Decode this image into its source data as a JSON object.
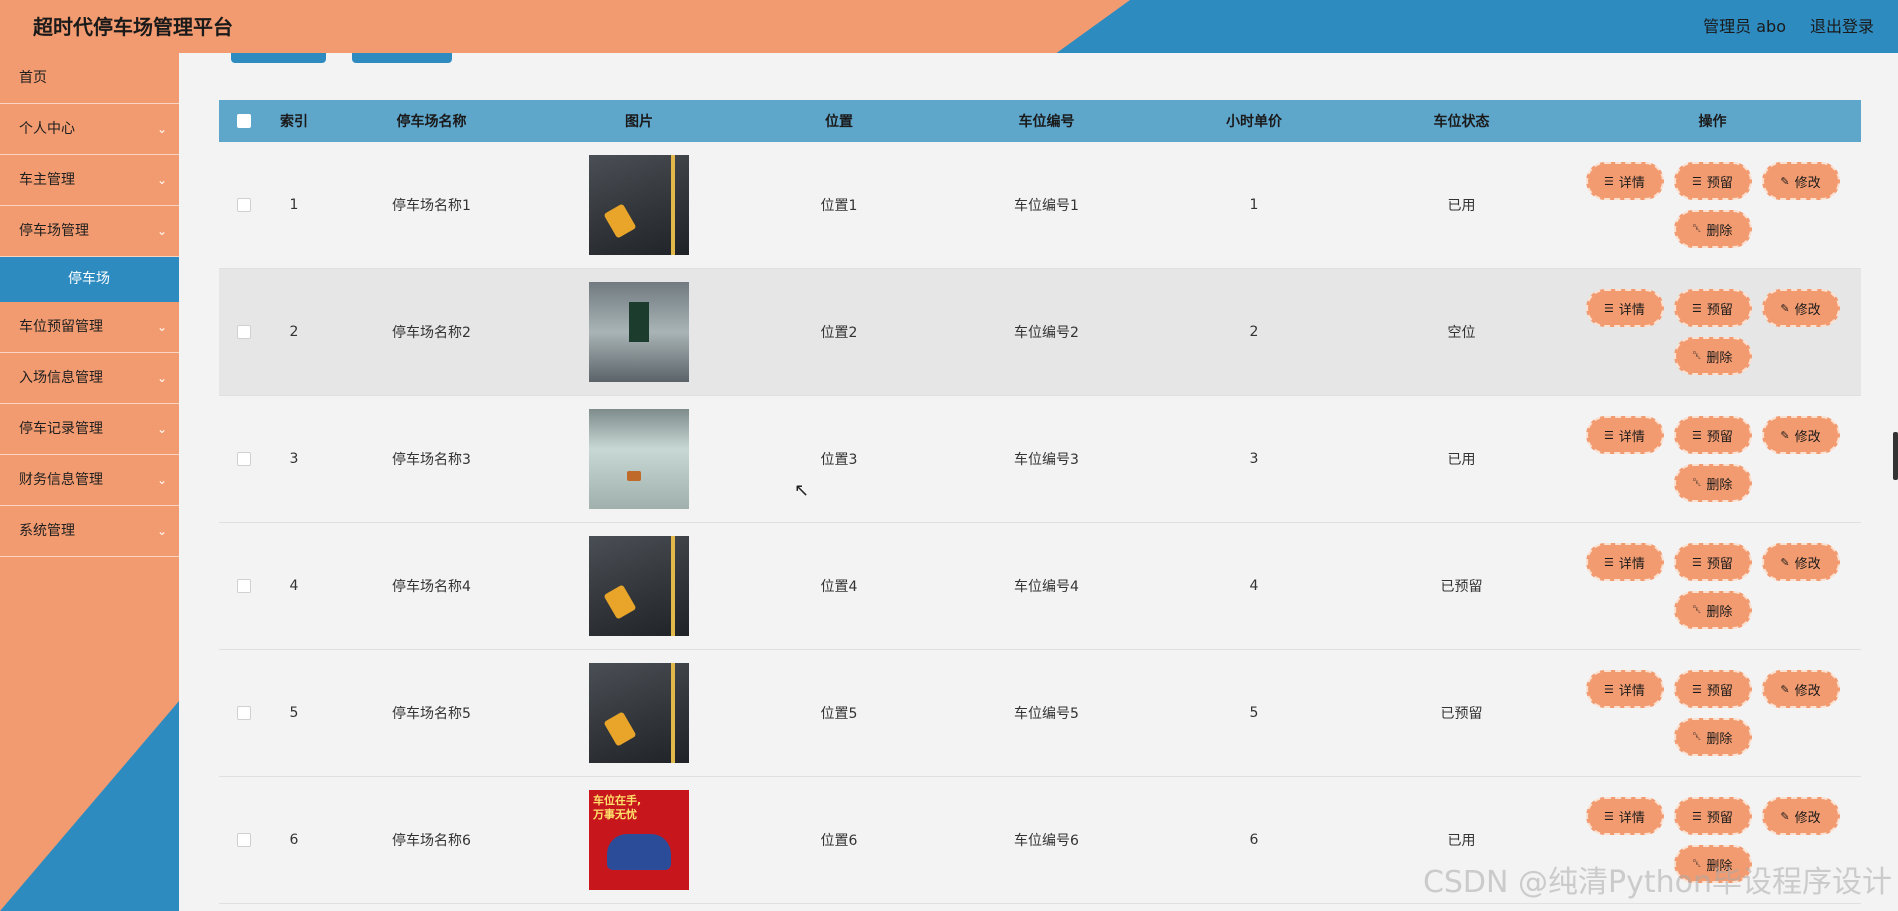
{
  "header": {
    "title": "超时代停车场管理平台",
    "user": "管理员 abo",
    "logout": "退出登录"
  },
  "sidebar": {
    "items": [
      {
        "label": "首页",
        "chevron": false
      },
      {
        "label": "个人中心",
        "chevron": true
      },
      {
        "label": "车主管理",
        "chevron": true
      },
      {
        "label": "停车场管理",
        "chevron": true
      },
      {
        "label": "停车场",
        "sub": true
      },
      {
        "label": "车位预留管理",
        "chevron": true
      },
      {
        "label": "入场信息管理",
        "chevron": true
      },
      {
        "label": "停车记录管理",
        "chevron": true
      },
      {
        "label": "财务信息管理",
        "chevron": true
      },
      {
        "label": "系统管理",
        "chevron": true
      }
    ]
  },
  "table": {
    "headers": [
      "索引",
      "停车场名称",
      "图片",
      "位置",
      "车位编号",
      "小时单价",
      "车位状态",
      "操作"
    ],
    "rows": [
      {
        "index": "1",
        "name": "停车场名称1",
        "image": "parking-lock",
        "location": "位置1",
        "space_no": "车位编号1",
        "price": "1",
        "status": "已用"
      },
      {
        "index": "2",
        "name": "停车场名称2",
        "image": "garage",
        "location": "位置2",
        "space_no": "车位编号2",
        "price": "2",
        "status": "空位"
      },
      {
        "index": "3",
        "name": "停车场名称3",
        "image": "white-garage",
        "location": "位置3",
        "space_no": "车位编号3",
        "price": "3",
        "status": "已用"
      },
      {
        "index": "4",
        "name": "停车场名称4",
        "image": "parking-lock",
        "location": "位置4",
        "space_no": "车位编号4",
        "price": "4",
        "status": "已预留"
      },
      {
        "index": "5",
        "name": "停车场名称5",
        "image": "parking-lock",
        "location": "位置5",
        "space_no": "车位编号5",
        "price": "5",
        "status": "已预留"
      },
      {
        "index": "6",
        "name": "停车场名称6",
        "image": "ad-poster",
        "location": "位置6",
        "space_no": "车位编号6",
        "price": "6",
        "status": "已用"
      }
    ],
    "ad_poster_text": "车位在手,\n万事无忧",
    "actions": [
      {
        "label": "详情",
        "icon": "document-icon"
      },
      {
        "label": "预留",
        "icon": "document-icon"
      },
      {
        "label": "修改",
        "icon": "edit-icon"
      },
      {
        "label": "删除",
        "icon": "trash-icon"
      }
    ]
  },
  "watermark": "CSDN @纯清Python毕设程序设计",
  "colors": {
    "orange": "#f29b70",
    "blue": "#2e8bc0",
    "table_header": "#5fa6cb"
  }
}
